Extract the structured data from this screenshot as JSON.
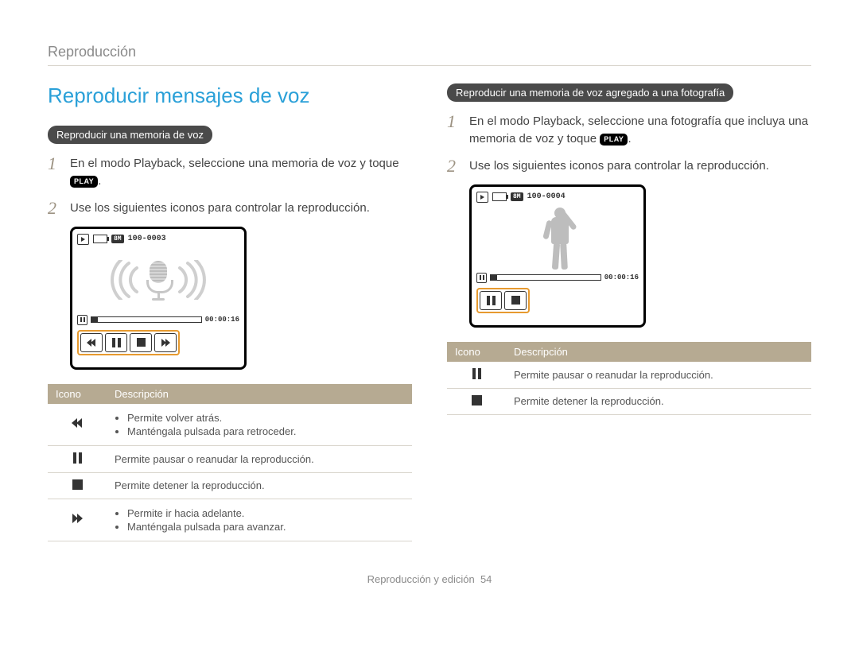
{
  "breadcrumb": "Reproducción",
  "title": "Reproducir mensajes de voz",
  "play_label": "PLAY",
  "left": {
    "pill": "Reproducir una memoria de voz",
    "step1": "En el modo Playback, seleccione una memoria de voz y toque ",
    "step1_after": ".",
    "step2": "Use los siguientes iconos para controlar la reproducción.",
    "device": {
      "file": "100-0003",
      "badge": "8M",
      "time": "00:00:16"
    },
    "table": {
      "h_icon": "Icono",
      "h_desc": "Descripción",
      "rw_a": "Permite volver atrás.",
      "rw_b": "Manténgala pulsada para retroceder.",
      "pause": "Permite pausar o reanudar la reproducción.",
      "stop": "Permite detener la reproducción.",
      "ff_a": "Permite ir hacia adelante.",
      "ff_b": "Manténgala pulsada para avanzar."
    }
  },
  "right": {
    "pill": "Reproducir una memoria de voz agregado a una fotografía",
    "step1a": "En el modo Playback, seleccione una fotografía que incluya una memoria de voz y toque ",
    "step1b": ".",
    "step2": "Use los siguientes iconos para controlar la reproducción.",
    "device": {
      "file": "100-0004",
      "badge": "8M",
      "time": "00:00:16"
    },
    "table": {
      "h_icon": "Icono",
      "h_desc": "Descripción",
      "pause": "Permite pausar o reanudar la reproducción.",
      "stop": "Permite detener la reproducción."
    }
  },
  "footer": {
    "section": "Reproducción y edición",
    "page": "54"
  }
}
